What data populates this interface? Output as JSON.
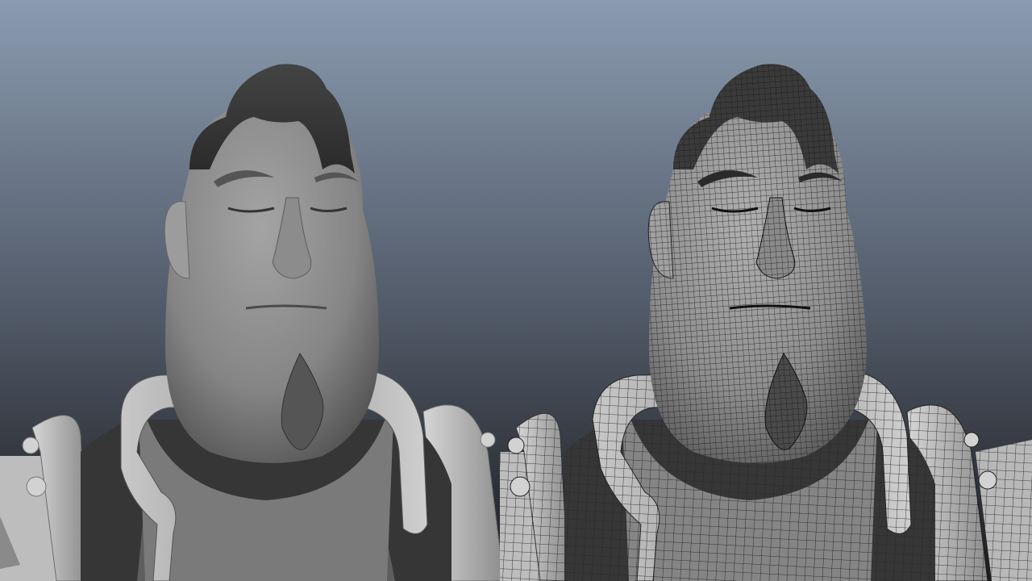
{
  "viewport": {
    "background_top": "#8b9bb0",
    "background_bottom": "#1c1c1e",
    "panels": [
      {
        "name": "shaded-view",
        "shading": "smooth-shaded",
        "surface_color": "#8a8a8a"
      },
      {
        "name": "wireframe-on-shaded-view",
        "shading": "wireframe-on-shaded",
        "surface_color": "#9a9a9a",
        "wire_color": "#1a1a1a"
      }
    ]
  }
}
